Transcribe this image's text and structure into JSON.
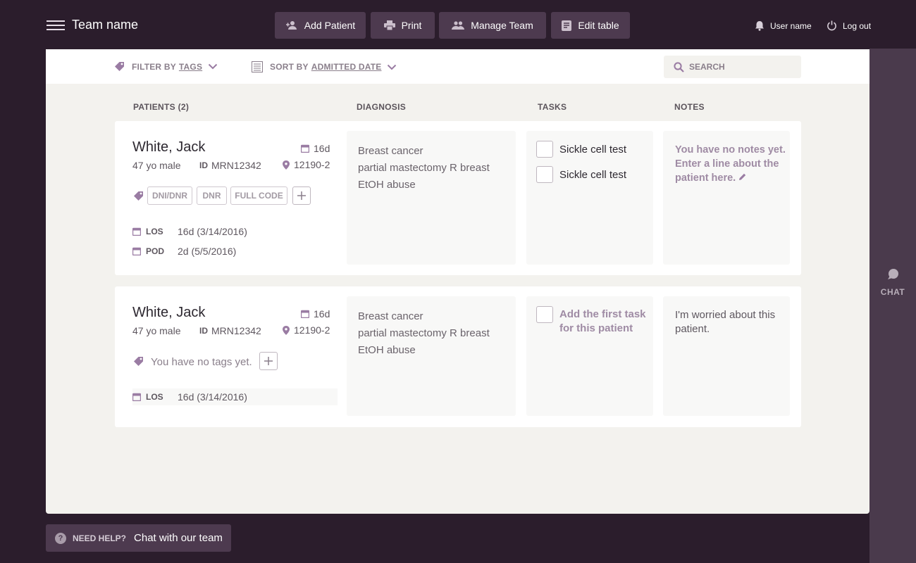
{
  "header": {
    "team_name": "Team name",
    "buttons": {
      "add_patient": "Add Patient",
      "print": "Print",
      "manage_team": "Manage Team",
      "edit_table": "Edit table"
    },
    "user_name": "User name",
    "logout": "Log out"
  },
  "filters": {
    "filter_label": "FILTER BY",
    "filter_value": "TAGS",
    "sort_label": "SORT BY",
    "sort_value": "ADMITTED DATE",
    "search_placeholder": "SEARCH"
  },
  "columns": {
    "patients": "PATIENTS (2)",
    "diagnosis": "DIAGNOSIS",
    "tasks": "TASKS",
    "notes": "NOTES"
  },
  "patients": [
    {
      "name": "White, Jack",
      "days": "16d",
      "age_sex": "47 yo male",
      "id_label": "ID",
      "mrn": "MRN12342",
      "room": "12190-2",
      "tags": [
        "DNI/DNR",
        "DNR",
        "FULL CODE"
      ],
      "dates": [
        {
          "label": "LOS",
          "value": "16d (3/14/2016)"
        },
        {
          "label": "POD",
          "value": "2d (5/5/2016)"
        }
      ],
      "diagnosis": [
        "Breast cancer",
        "partial mastectomy R breast",
        "EtOH abuse"
      ],
      "tasks": [
        "Sickle cell test",
        "Sickle cell test"
      ],
      "notes_placeholder": "You have no notes yet. Enter a line about the patient here."
    },
    {
      "name": "White, Jack",
      "days": "16d",
      "age_sex": "47 yo male",
      "id_label": "ID",
      "mrn": "MRN12342",
      "room": "12190-2",
      "no_tags": "You have no tags yet.",
      "dates": [
        {
          "label": "LOS",
          "value": "16d (3/14/2016)"
        }
      ],
      "diagnosis": [
        "Breast cancer",
        "partial mastectomy R breast",
        "EtOH abuse"
      ],
      "task_placeholder": "Add the first task for this patient",
      "notes": "I'm worried about this patient."
    }
  ],
  "chat": {
    "label": "CHAT"
  },
  "help": {
    "need_help": "NEED HELP?",
    "chat_link": "Chat with our team"
  },
  "colors": {
    "background": "#2b1d2c",
    "button": "#4d3a4f",
    "accent": "#8a6a92",
    "panel": "#f3f2ee"
  }
}
